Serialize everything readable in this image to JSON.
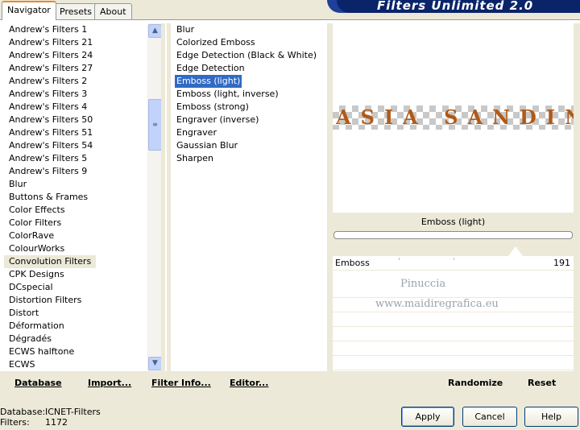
{
  "tabs": [
    "Navigator",
    "Presets",
    "About"
  ],
  "banner_title": "Filters Unlimited 2.0",
  "categories": [
    "Andrew's Filters 1",
    "Andrew's Filters 21",
    "Andrew's Filters 24",
    "Andrew's Filters 27",
    "Andrew's Filters 2",
    "Andrew's Filters 3",
    "Andrew's Filters 4",
    "Andrew's Filters 50",
    "Andrew's Filters 51",
    "Andrew's Filters 54",
    "Andrew's Filters 5",
    "Andrew's Filters 9",
    "Blur",
    "Buttons & Frames",
    "Color Effects",
    "Color Filters",
    "ColorRave",
    "ColourWorks",
    "Convolution Filters",
    "CPK Designs",
    "DCspecial",
    "Distortion Filters",
    "Distort",
    "Déformation",
    "Dégradés",
    "ECWS halftone",
    "ECWS"
  ],
  "selected_category": "Convolution Filters",
  "filters": [
    "Blur",
    "Colorized Emboss",
    "Edge Detection (Black & White)",
    "Edge Detection",
    "Emboss (light)",
    "Emboss (light, inverse)",
    "Emboss (strong)",
    "Engraver (inverse)",
    "Engraver",
    "Gaussian Blur",
    "Sharpen"
  ],
  "selected_filter": "Emboss (light)",
  "preview_text": "ASIA SANDIN",
  "filter_name": "Emboss (light)",
  "controls": [
    {
      "label": "Emboss",
      "value": "191"
    }
  ],
  "watermark": {
    "line1": "Pinuccia",
    "line2": "www.maidiregrafica.eu"
  },
  "toolbar": {
    "database": "Database",
    "import": "Import...",
    "filter_info": "Filter Info...",
    "editor": "Editor...",
    "randomize": "Randomize",
    "reset": "Reset"
  },
  "status": {
    "database_label": "Database:",
    "database_value": "ICNET-Filters",
    "filters_label": "Filters:",
    "filters_value": "1172"
  },
  "buttons": {
    "apply": "Apply",
    "cancel": "Cancel",
    "help": "Help"
  },
  "icons": {
    "scroll_up": "up-arrow-icon",
    "scroll_down": "down-arrow-icon",
    "scroll_grip": "grip-icon"
  }
}
